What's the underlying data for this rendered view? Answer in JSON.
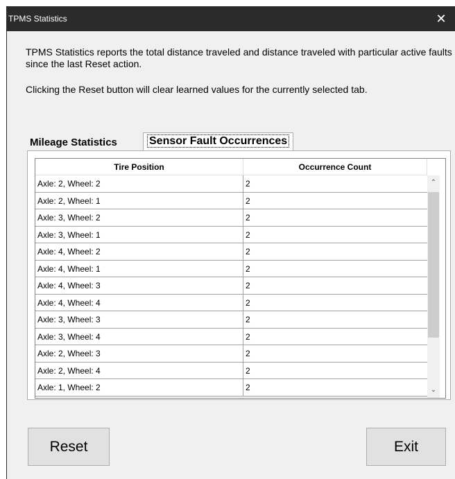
{
  "window": {
    "title": "TPMS Statistics",
    "close_glyph": "✕"
  },
  "description": {
    "line1": "TPMS Statistics reports the total distance traveled and distance traveled with particular active faults since the last Reset action.",
    "line2": "Clicking the Reset button will clear learned values for the currently selected tab."
  },
  "tabs": [
    {
      "label": "Mileage Statistics",
      "selected": false
    },
    {
      "label": "Sensor Fault Occurrences",
      "selected": true
    }
  ],
  "grid": {
    "columns": [
      "Tire Position",
      "Occurrence Count"
    ],
    "rows": [
      {
        "position": "Axle: 2, Wheel: 2",
        "count": "2"
      },
      {
        "position": "Axle: 2, Wheel: 1",
        "count": "2"
      },
      {
        "position": "Axle: 3, Wheel: 2",
        "count": "2"
      },
      {
        "position": "Axle: 3, Wheel: 1",
        "count": "2"
      },
      {
        "position": "Axle: 4, Wheel: 2",
        "count": "2"
      },
      {
        "position": "Axle: 4, Wheel: 1",
        "count": "2"
      },
      {
        "position": "Axle: 4, Wheel: 3",
        "count": "2"
      },
      {
        "position": "Axle: 4, Wheel: 4",
        "count": "2"
      },
      {
        "position": "Axle: 3, Wheel: 3",
        "count": "2"
      },
      {
        "position": "Axle: 3, Wheel: 4",
        "count": "2"
      },
      {
        "position": "Axle: 2, Wheel: 3",
        "count": "2"
      },
      {
        "position": "Axle: 2, Wheel: 4",
        "count": "2"
      },
      {
        "position": "Axle: 1, Wheel: 2",
        "count": "2"
      }
    ],
    "scroll": {
      "up_icon": "chevron-up-icon",
      "down_icon": "chevron-down-icon",
      "up_glyph": "⌃",
      "down_glyph": "⌄"
    }
  },
  "buttons": {
    "reset": "Reset",
    "exit": "Exit"
  }
}
